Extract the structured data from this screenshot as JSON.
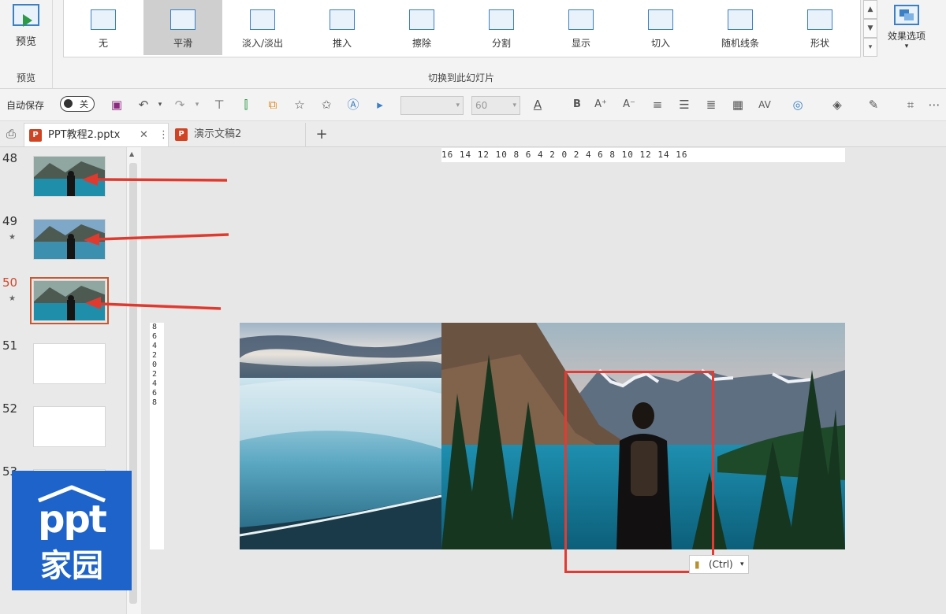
{
  "ribbon": {
    "preview_label": "预览",
    "preview_group_label": "预览",
    "transitions": [
      {
        "label": "无",
        "icon": "none-transition-icon"
      },
      {
        "label": "平滑",
        "icon": "morph-transition-icon",
        "selected": true
      },
      {
        "label": "淡入/淡出",
        "icon": "fade-transition-icon"
      },
      {
        "label": "推入",
        "icon": "push-transition-icon"
      },
      {
        "label": "擦除",
        "icon": "wipe-transition-icon"
      },
      {
        "label": "分割",
        "icon": "split-transition-icon"
      },
      {
        "label": "显示",
        "icon": "reveal-transition-icon"
      },
      {
        "label": "切入",
        "icon": "cut-transition-icon"
      },
      {
        "label": "随机线条",
        "icon": "random-bars-transition-icon"
      },
      {
        "label": "形状",
        "icon": "shape-transition-icon"
      }
    ],
    "effect_options_label": "效果选项",
    "group_label": "切换到此幻灯片"
  },
  "qat": {
    "autosave_label": "自动保存",
    "autosave_state": "关",
    "font_size": "60"
  },
  "tabs": [
    {
      "label": "PPT教程2.pptx",
      "active": true
    },
    {
      "label": "演示文稿2",
      "active": false
    }
  ],
  "tabs_new_label": "+",
  "slides": [
    {
      "number": "48",
      "image": "lake-person",
      "starred": false,
      "active": false
    },
    {
      "number": "49",
      "image": "waterfall-person",
      "starred": true,
      "active": false
    },
    {
      "number": "50",
      "image": "lake-person",
      "starred": true,
      "active": true
    },
    {
      "number": "51",
      "image": "blank",
      "starred": false,
      "active": false
    },
    {
      "number": "52",
      "image": "blank",
      "starred": false,
      "active": false
    },
    {
      "number": "53",
      "image": "blank",
      "starred": false,
      "active": false
    }
  ],
  "ruler": {
    "horizontal": "16 14 12 10 8 6 4 2 0 2 4 6 8 10 12 14 16",
    "vertical": "8 6 4 2 0 2 4 6 8"
  },
  "paste_options_label": "(Ctrl)",
  "logo": {
    "line1": "ppt",
    "line2": "家园"
  },
  "colors": {
    "accent_selection": "#e53a32",
    "annotation_arrow": "#e03a2f",
    "active_slide": "#c9572f",
    "logo_blue": "#1d63c9"
  }
}
